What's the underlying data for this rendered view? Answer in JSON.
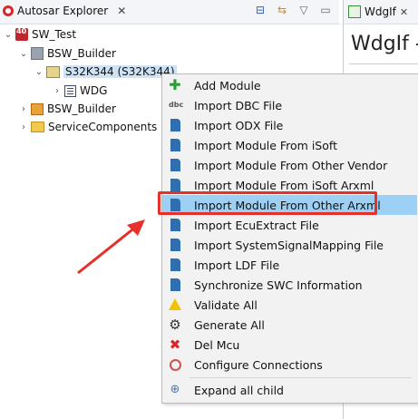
{
  "explorer": {
    "title": "Autosar Explorer",
    "close_glyph": "✕",
    "toolbar": [
      {
        "icon": "collapse-all-icon",
        "glyph": "⊟"
      },
      {
        "icon": "link-editor-icon",
        "glyph": "⇆"
      },
      {
        "icon": "view-menu-icon",
        "glyph": "▽"
      },
      {
        "icon": "minimize-icon",
        "glyph": "▭"
      }
    ]
  },
  "tree": {
    "items": [
      {
        "label": "SW_Test",
        "twisty": "⌄",
        "icon": "project-icon"
      },
      {
        "label": "BSW_Builder",
        "twisty": "⌄",
        "icon": "bsw-builder-icon"
      },
      {
        "label": "S32K344 (S32K344)",
        "twisty": "⌄",
        "icon": "ecu-chip-icon"
      },
      {
        "label": "WDG",
        "twisty": "›",
        "icon": "module-list-icon"
      },
      {
        "label": "BSW_Builder",
        "twisty": "›",
        "icon": "bsw-package-icon"
      },
      {
        "label": "ServiceComponents",
        "twisty": "›",
        "icon": "folder-icon"
      }
    ]
  },
  "editor": {
    "tab_label": "WdgIf",
    "tab_close": "✕",
    "heading": "WdgIf -"
  },
  "context_menu": {
    "items": [
      {
        "label": "Add Module",
        "icon": "add-icon",
        "glyph": "✚"
      },
      {
        "label": "Import DBC File",
        "icon": "dbc-icon",
        "glyph": "dbc"
      },
      {
        "label": "Import ODX File",
        "icon": "import-file-icon",
        "glyph": ""
      },
      {
        "label": "Import Module From iSoft",
        "icon": "import-file-icon",
        "glyph": ""
      },
      {
        "label": "Import Module From Other Vendor",
        "icon": "import-file-icon",
        "glyph": ""
      },
      {
        "label": "Import Module From iSoft Arxml",
        "icon": "import-file-icon",
        "glyph": ""
      },
      {
        "label": "Import Module From Other Arxml",
        "icon": "import-file-icon",
        "glyph": "",
        "highlighted": true
      },
      {
        "label": "Import EcuExtract File",
        "icon": "import-file-icon",
        "glyph": ""
      },
      {
        "label": "Import SystemSignalMapping File",
        "icon": "import-file-icon",
        "glyph": ""
      },
      {
        "label": "Import LDF File",
        "icon": "import-file-icon",
        "glyph": ""
      },
      {
        "label": "Synchronize SWC Information",
        "icon": "import-file-icon",
        "glyph": ""
      },
      {
        "label": "Validate All",
        "icon": "warning-icon",
        "glyph": ""
      },
      {
        "label": "Generate All",
        "icon": "gear-icon",
        "glyph": "⚙"
      },
      {
        "label": "Del Mcu",
        "icon": "delete-icon",
        "glyph": "✖"
      },
      {
        "label": "Configure Connections",
        "icon": "connection-icon",
        "glyph": ""
      },
      {
        "label": "Expand all child",
        "icon": "expand-tree-icon",
        "glyph": "⊕"
      }
    ]
  },
  "annotation": {
    "highlight_color": "#e8302a",
    "menu_highlight_color": "#9dd0f5"
  }
}
